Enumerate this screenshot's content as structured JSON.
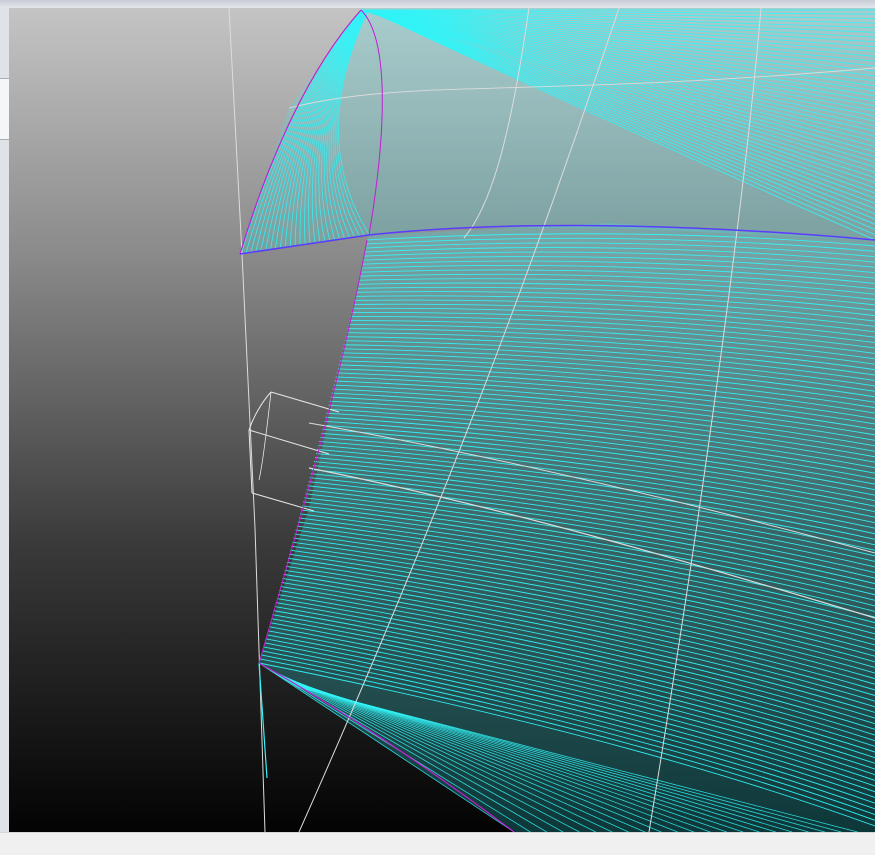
{
  "viewport": {
    "background_top": "#c4c4c4",
    "background_bottom": "#030303",
    "surface_line_color": "#32f3f7",
    "surface_edge_color": "#c020d0",
    "grid_line_color": "#dcdcdc",
    "box_line_color": "#e8e8e8"
  },
  "status_bar": {
    "text": ""
  }
}
